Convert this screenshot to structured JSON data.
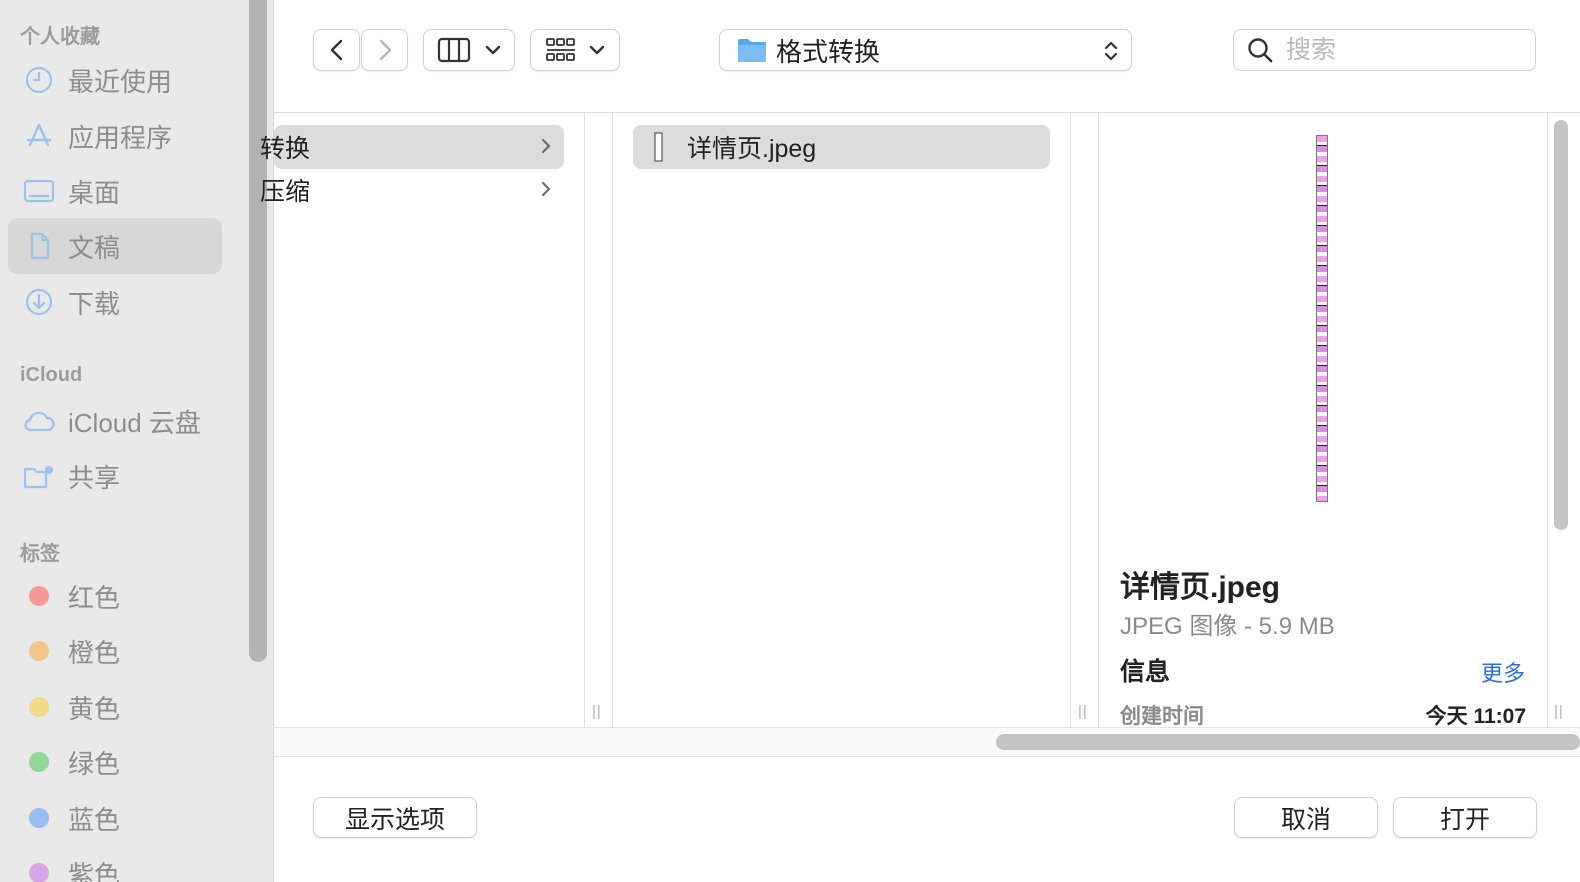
{
  "sidebar": {
    "favorites_label": "个人收藏",
    "favorites": [
      {
        "label": "最近使用",
        "icon": "clock-icon"
      },
      {
        "label": "应用程序",
        "icon": "applications-icon"
      },
      {
        "label": "桌面",
        "icon": "desktop-icon"
      },
      {
        "label": "文稿",
        "icon": "document-icon",
        "selected": true
      },
      {
        "label": "下载",
        "icon": "download-icon"
      }
    ],
    "icloud_label": "iCloud",
    "icloud": [
      {
        "label": "iCloud 云盘",
        "icon": "cloud-icon"
      },
      {
        "label": "共享",
        "icon": "shared-folder-icon"
      }
    ],
    "tags_label": "标签",
    "tags": [
      {
        "label": "红色",
        "color": "#f29b98"
      },
      {
        "label": "橙色",
        "color": "#f3c58d"
      },
      {
        "label": "黄色",
        "color": "#f1d98a"
      },
      {
        "label": "绿色",
        "color": "#92d69a"
      },
      {
        "label": "蓝色",
        "color": "#97bdf1"
      },
      {
        "label": "紫色",
        "color": "#d5a7e6"
      }
    ]
  },
  "toolbar": {
    "path_folder": "格式转换",
    "search_placeholder": "搜索"
  },
  "columns": {
    "col1": [
      "转换",
      "压缩"
    ],
    "col2": [
      "详情页.jpeg"
    ]
  },
  "preview": {
    "filename": "详情页.jpeg",
    "kind_size": "JPEG 图像 - 5.9 MB",
    "info_label": "信息",
    "more_label": "更多",
    "created_label": "创建时间",
    "created_value": "今天 11:07"
  },
  "buttons": {
    "options": "显示选项",
    "cancel": "取消",
    "open": "打开"
  },
  "colors": {
    "accent": "#2a6fdc",
    "folder": "#5aa8ea"
  }
}
